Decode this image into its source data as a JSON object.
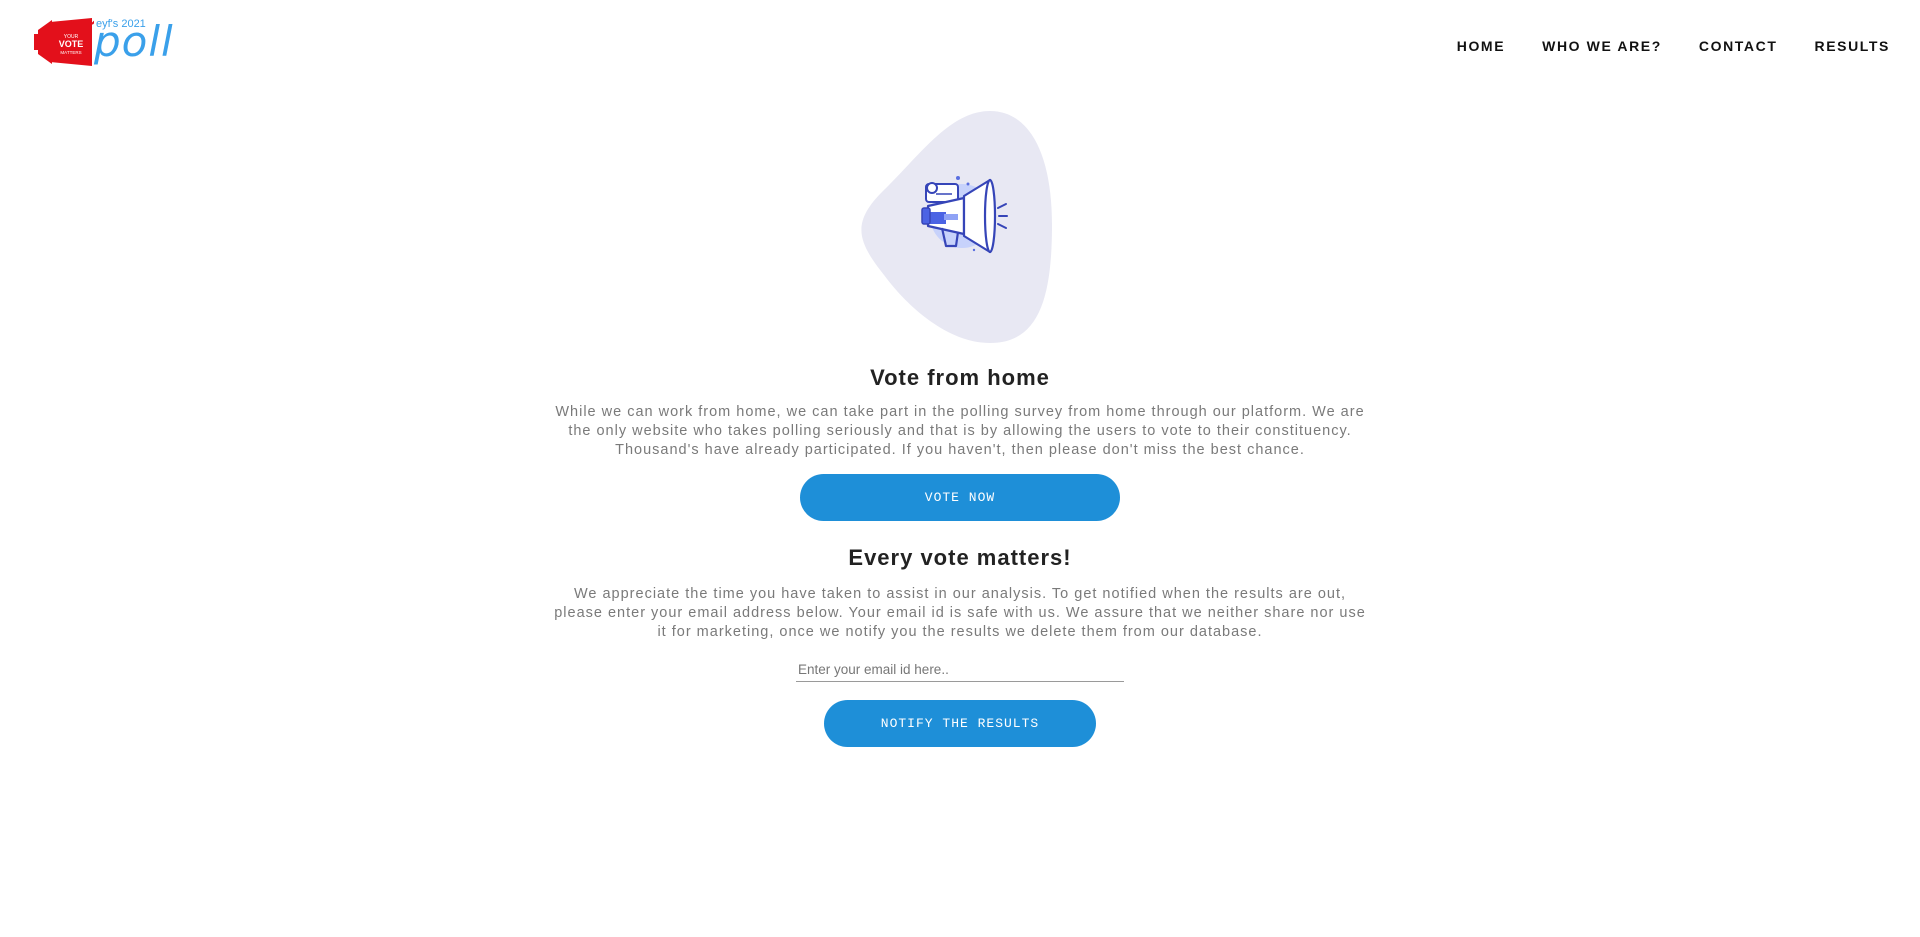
{
  "logo": {
    "year_text": "eyf's 2021",
    "word": "poll",
    "badge_line1": "YOUR",
    "badge_line2": "VOTE",
    "badge_line3": "MATTERS"
  },
  "nav": {
    "items": [
      {
        "label": "HOME"
      },
      {
        "label": "WHO WE ARE?"
      },
      {
        "label": "CONTACT"
      },
      {
        "label": "RESULTS"
      }
    ]
  },
  "hero": {
    "icon": "megaphone-icon"
  },
  "vote_section": {
    "title": "Vote from home",
    "text": "While we can work from home, we can take part in the polling survey from home through our platform. We are the only website who takes polling seriously and that is by allowing the users to vote to their constituency. Thousand's have already participated. If you haven't, then please don't miss the best chance.",
    "button_label": "VOTE NOW"
  },
  "notify_section": {
    "title": "Every vote matters!",
    "text": "We appreciate the time you have taken to assist in our analysis. To get notified when the results are out, please enter your email address below. Your email id is safe with us. We assure that we neither share nor use it for marketing, once we notify you the results we delete them from our database.",
    "email_placeholder": "Enter your email id here..",
    "email_value": "",
    "button_label": "NOTIFY THE RESULTS"
  },
  "colors": {
    "accent": "#1e8fd8",
    "logo_blue": "#3aa0ea",
    "logo_red": "#e3101b",
    "blob": "#e8e8f3"
  }
}
